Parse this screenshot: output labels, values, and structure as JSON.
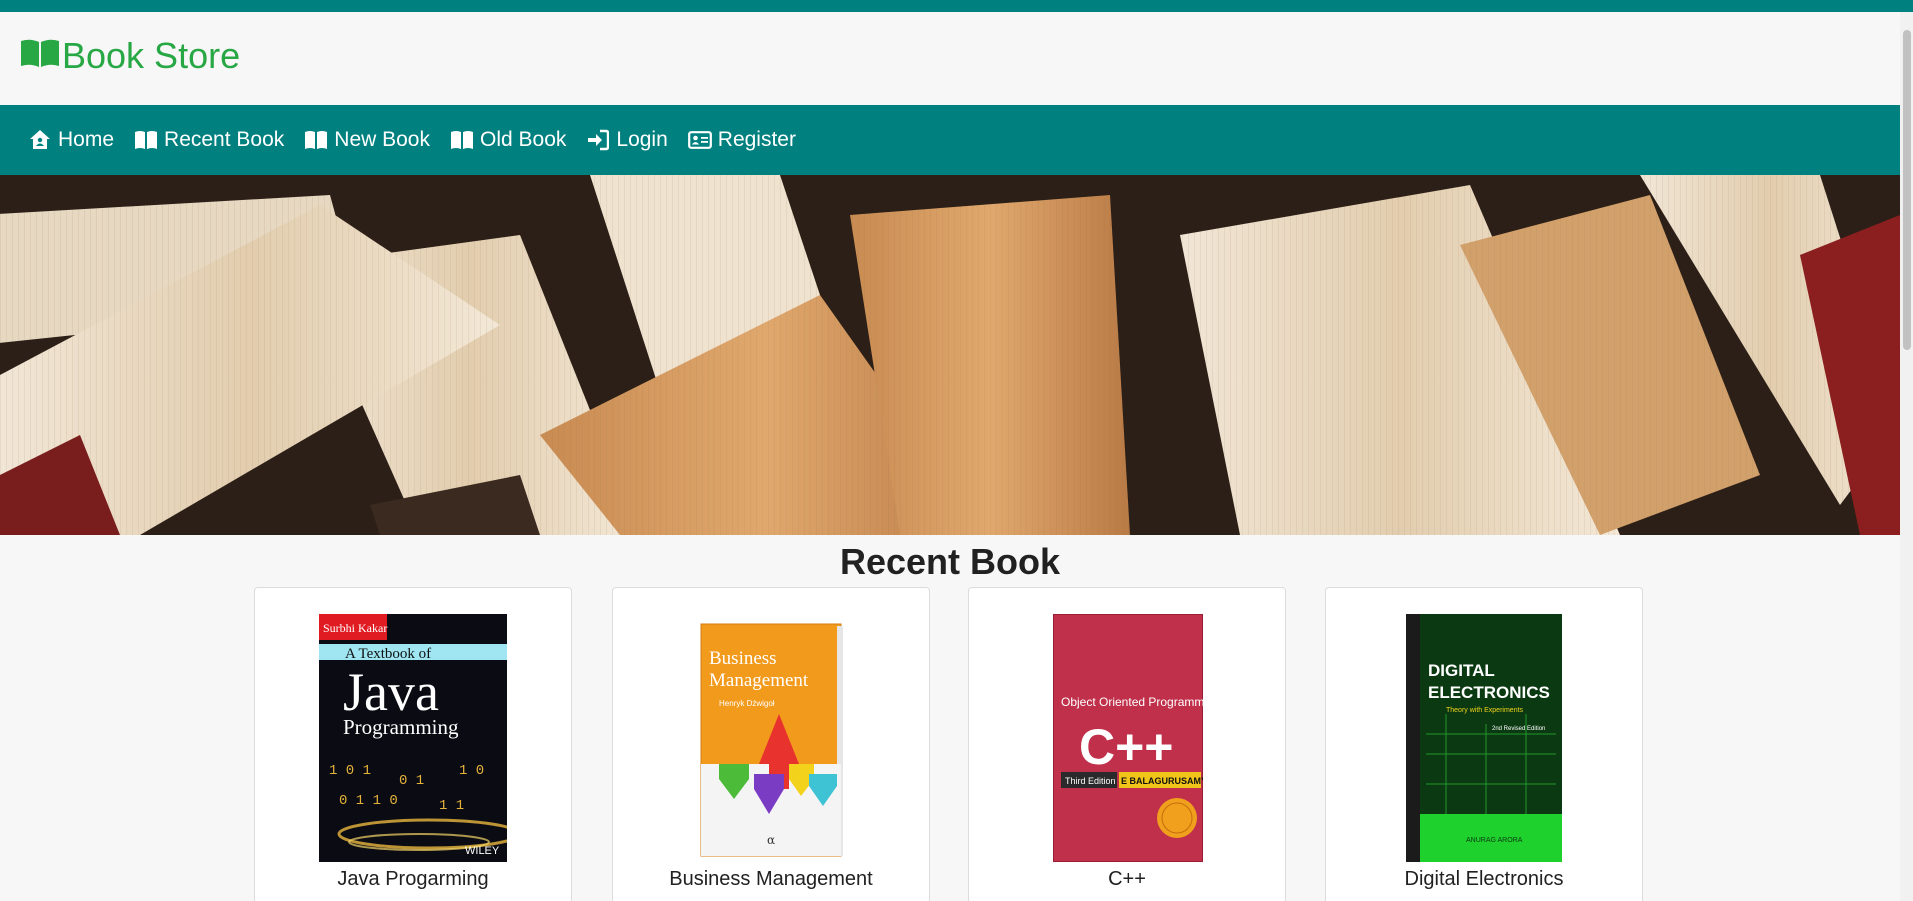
{
  "brand": {
    "title": "Book Store",
    "color": "#28a745"
  },
  "theme": {
    "primary": "#00807f",
    "background": "#f7f7f7"
  },
  "nav": {
    "items": [
      {
        "label": "Home",
        "icon": "home-icon"
      },
      {
        "label": "Recent Book",
        "icon": "open-book-icon"
      },
      {
        "label": "New Book",
        "icon": "open-book-icon"
      },
      {
        "label": "Old Book",
        "icon": "open-book-icon"
      },
      {
        "label": "Login",
        "icon": "sign-in-icon"
      },
      {
        "label": "Register",
        "icon": "id-card-icon"
      }
    ]
  },
  "section": {
    "title": "Recent Book"
  },
  "books": [
    {
      "title": "Java Progarming",
      "cover": {
        "author": "Surbhi Kakar",
        "line1": "A Textbook of",
        "line2": "Java",
        "line3": "Programming",
        "publisher": "WILEY"
      }
    },
    {
      "title": "Business Management",
      "cover": {
        "line1": "Business",
        "line2": "Management",
        "author": "Henryk Dźwigoł"
      }
    },
    {
      "title": "C++",
      "cover": {
        "line1": "Object Oriented Programming",
        "line2": "C++",
        "edition": "Third Edition",
        "author": "E BALAGURUSAMY"
      }
    },
    {
      "title": "Digital Electronics",
      "cover": {
        "line1": "DIGITAL",
        "line2": "ELECTRONICS",
        "subtitle": "Theory with Experiments",
        "edition": "2nd Revised Edition",
        "author": "ANURAG ARORA"
      }
    }
  ]
}
